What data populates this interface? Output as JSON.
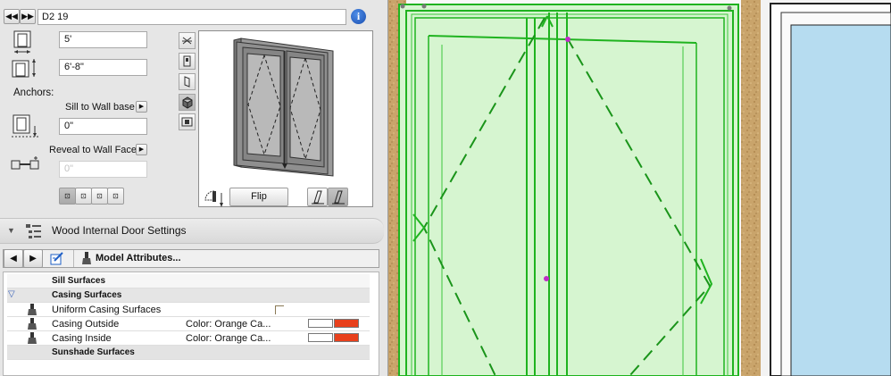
{
  "header": {
    "element_id": "D2 19",
    "info_icon": "info-icon"
  },
  "size": {
    "width": "5'",
    "height": "6'-8\""
  },
  "anchors": {
    "label": "Anchors:",
    "sill_dropdown": "Sill to Wall base",
    "sill_value": "0\"",
    "reveal_dropdown": "Reveal to Wall Face",
    "reveal_value": "0\""
  },
  "preview": {
    "flip_label": "Flip"
  },
  "settings": {
    "title": "Wood Internal Door Settings",
    "model_attributes_label": "Model Attributes..."
  },
  "attributes": {
    "rows": [
      {
        "label": "Sill Surfaces",
        "type": "header"
      },
      {
        "label": "Casing Surfaces",
        "type": "header",
        "expanded": true
      },
      {
        "label": "Uniform Casing Surfaces",
        "type": "checkbox",
        "checked": false
      },
      {
        "label": "Casing Outside",
        "type": "surface",
        "value": "Color: Orange Ca...",
        "colors": [
          "#ffffff",
          "#e8401c"
        ]
      },
      {
        "label": "Casing Inside",
        "type": "surface",
        "value": "Color: Orange Ca...",
        "colors": [
          "#ffffff",
          "#e8401c"
        ]
      },
      {
        "label": "Sunshade Surfaces",
        "type": "header"
      }
    ]
  },
  "colors": {
    "accent_blue": "#1e5fc6",
    "selection_green": "#1fb31f",
    "swatch_orange": "#e8401c",
    "glass_blue": "#b6dcf0"
  }
}
